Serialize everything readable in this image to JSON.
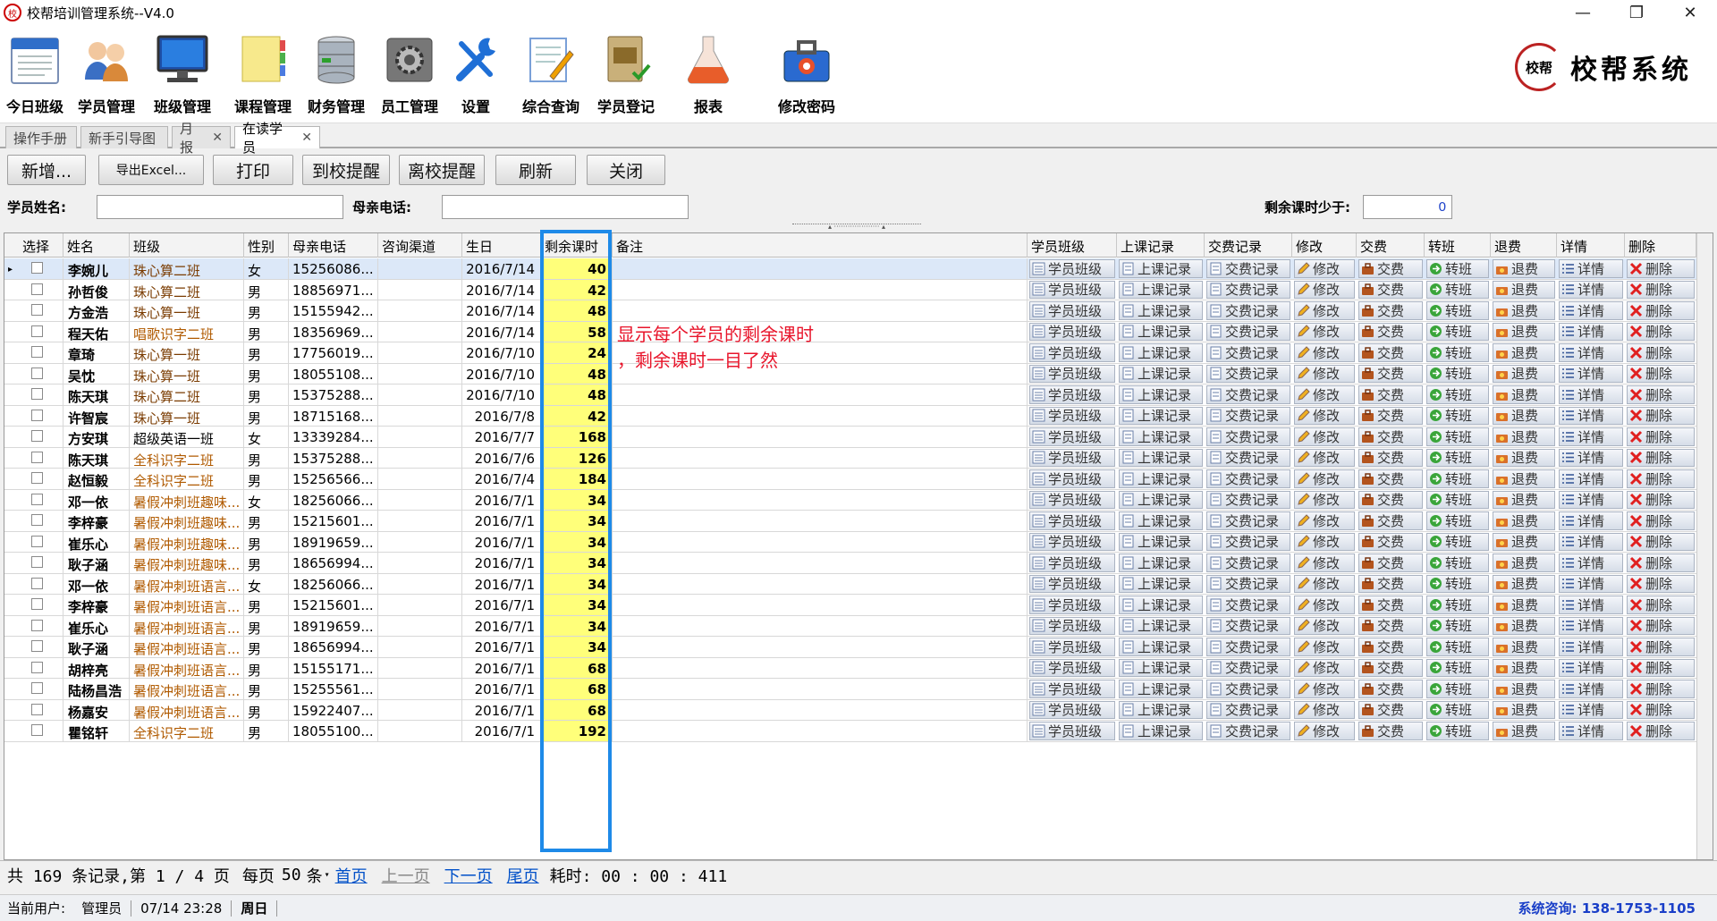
{
  "window": {
    "title": "校帮培训管理系统--V4.0",
    "minimize": "—",
    "restore": "❐",
    "close": "✕",
    "logo_glyph": "校"
  },
  "ribbon": [
    {
      "label": "今日班级",
      "icon": "calendar-icon"
    },
    {
      "label": "学员管理",
      "icon": "users-icon"
    },
    {
      "label": "班级管理",
      "icon": "monitor-icon"
    },
    {
      "label": "课程管理",
      "icon": "notes-icon"
    },
    {
      "label": "财务管理",
      "icon": "database-icon"
    },
    {
      "label": "员工管理",
      "icon": "gear-icon"
    },
    {
      "label": "设置",
      "icon": "tools-icon"
    },
    {
      "label": "综合查询",
      "icon": "pencil-doc-icon"
    },
    {
      "label": "学员登记",
      "icon": "book-icon"
    },
    {
      "label": "报表",
      "icon": "flask-icon"
    },
    {
      "label": "修改密码",
      "icon": "toolbox-icon"
    }
  ],
  "brand": {
    "seal": "校帮",
    "text": "校帮系统"
  },
  "tabs": [
    {
      "label": "操作手册",
      "closable": false
    },
    {
      "label": "新手引导图",
      "closable": false
    },
    {
      "label": "月报",
      "closable": true
    },
    {
      "label": "在读学员",
      "closable": true,
      "active": true
    }
  ],
  "toolbar": {
    "add": "新增...",
    "export": "导出Excel...",
    "print": "打印",
    "arrive": "到校提醒",
    "leave": "离校提醒",
    "refresh": "刷新",
    "close": "关闭"
  },
  "search": {
    "name_label": "学员姓名:",
    "name_value": "",
    "phone_label": "母亲电话:",
    "phone_value": "",
    "remain_label": "剩余课时少于:",
    "remain_value": "0"
  },
  "columns": [
    "选择",
    "姓名",
    "班级",
    "性别",
    "母亲电话",
    "咨询渠道",
    "生日",
    "剩余课时",
    "备注",
    "学员班级",
    "上课记录",
    "交费记录",
    "修改",
    "交费",
    "转班",
    "退费",
    "详情",
    "删除"
  ],
  "row_actions": [
    "学员班级",
    "上课记录",
    "交费记录",
    "修改",
    "交费",
    "转班",
    "退费",
    "详情",
    "删除"
  ],
  "rows": [
    {
      "name": "李婉儿",
      "class": "珠心算二班",
      "gender": "女",
      "phone": "15256086...",
      "birthday": "2016/7/14",
      "remain": "40"
    },
    {
      "name": "孙哲俊",
      "class": "珠心算二班",
      "gender": "男",
      "phone": "18856971...",
      "birthday": "2016/7/14",
      "remain": "42"
    },
    {
      "name": "方金浩",
      "class": "珠心算一班",
      "gender": "男",
      "phone": "15155942...",
      "birthday": "2016/7/14",
      "remain": "48"
    },
    {
      "name": "程天佑",
      "class": "唱歌识字二班",
      "gender": "男",
      "phone": "18356969...",
      "birthday": "2016/7/14",
      "remain": "58"
    },
    {
      "name": "章琦",
      "class": "珠心算一班",
      "gender": "男",
      "phone": "17756019...",
      "birthday": "2016/7/10",
      "remain": "24"
    },
    {
      "name": "吴忱",
      "class": "珠心算一班",
      "gender": "男",
      "phone": "18055108...",
      "birthday": "2016/7/10",
      "remain": "48"
    },
    {
      "name": "陈天琪",
      "class": "珠心算二班",
      "gender": "男",
      "phone": "15375288...",
      "birthday": "2016/7/10",
      "remain": "48"
    },
    {
      "name": "许智宸",
      "class": "珠心算一班",
      "gender": "男",
      "phone": "18715168...",
      "birthday": "2016/7/8",
      "remain": "42"
    },
    {
      "name": "方安琪",
      "class": "超级英语一班",
      "gender": "女",
      "phone": "13339284...",
      "birthday": "2016/7/7",
      "remain": "168"
    },
    {
      "name": "陈天琪",
      "class": "全科识字二班",
      "gender": "男",
      "phone": "15375288...",
      "birthday": "2016/7/6",
      "remain": "126"
    },
    {
      "name": "赵恒毅",
      "class": "全科识字二班",
      "gender": "男",
      "phone": "15256566...",
      "birthday": "2016/7/4",
      "remain": "184"
    },
    {
      "name": "邓一依",
      "class": "暑假冲刺班趣味...",
      "gender": "女",
      "phone": "18256066...",
      "birthday": "2016/7/1",
      "remain": "34"
    },
    {
      "name": "李梓豪",
      "class": "暑假冲刺班趣味...",
      "gender": "男",
      "phone": "15215601...",
      "birthday": "2016/7/1",
      "remain": "34"
    },
    {
      "name": "崔乐心",
      "class": "暑假冲刺班趣味...",
      "gender": "男",
      "phone": "18919659...",
      "birthday": "2016/7/1",
      "remain": "34"
    },
    {
      "name": "耿子涵",
      "class": "暑假冲刺班趣味...",
      "gender": "男",
      "phone": "18656994...",
      "birthday": "2016/7/1",
      "remain": "34"
    },
    {
      "name": "邓一依",
      "class": "暑假冲刺班语言...",
      "gender": "女",
      "phone": "18256066...",
      "birthday": "2016/7/1",
      "remain": "34"
    },
    {
      "name": "李梓豪",
      "class": "暑假冲刺班语言...",
      "gender": "男",
      "phone": "15215601...",
      "birthday": "2016/7/1",
      "remain": "34"
    },
    {
      "name": "崔乐心",
      "class": "暑假冲刺班语言...",
      "gender": "男",
      "phone": "18919659...",
      "birthday": "2016/7/1",
      "remain": "34"
    },
    {
      "name": "耿子涵",
      "class": "暑假冲刺班语言...",
      "gender": "男",
      "phone": "18656994...",
      "birthday": "2016/7/1",
      "remain": "34"
    },
    {
      "name": "胡梓亮",
      "class": "暑假冲刺班语言...",
      "gender": "男",
      "phone": "15155171...",
      "birthday": "2016/7/1",
      "remain": "68"
    },
    {
      "name": "陆杨昌浩",
      "class": "暑假冲刺班语言...",
      "gender": "男",
      "phone": "15255561...",
      "birthday": "2016/7/1",
      "remain": "68"
    },
    {
      "name": "杨嘉安",
      "class": "暑假冲刺班语言...",
      "gender": "男",
      "phone": "15922407...",
      "birthday": "2016/7/1",
      "remain": "68"
    },
    {
      "name": "瞿铭轩",
      "class": "全科识字二班",
      "gender": "男",
      "phone": "18055100...",
      "birthday": "2016/7/1",
      "remain": "192"
    }
  ],
  "annotation": {
    "line1": "显示每个学员的剩余课时",
    "line2": "，剩余课时一目了然",
    "color": "#e8152b"
  },
  "pager": {
    "total": "共 169 条记录,第 1 / 4 页",
    "per_page_label": "每页",
    "per_page": "50",
    "per_unit": "条",
    "first": "首页",
    "prev": "上一页",
    "next": "下一页",
    "last": "尾页",
    "elapsed": "耗时: 00 : 00 : 411"
  },
  "status": {
    "user_label": "当前用户:",
    "user": "管理员",
    "datetime": "07/14 23:28",
    "weekday": "周日",
    "consult": "系统咨询: 138-1753-1105"
  }
}
